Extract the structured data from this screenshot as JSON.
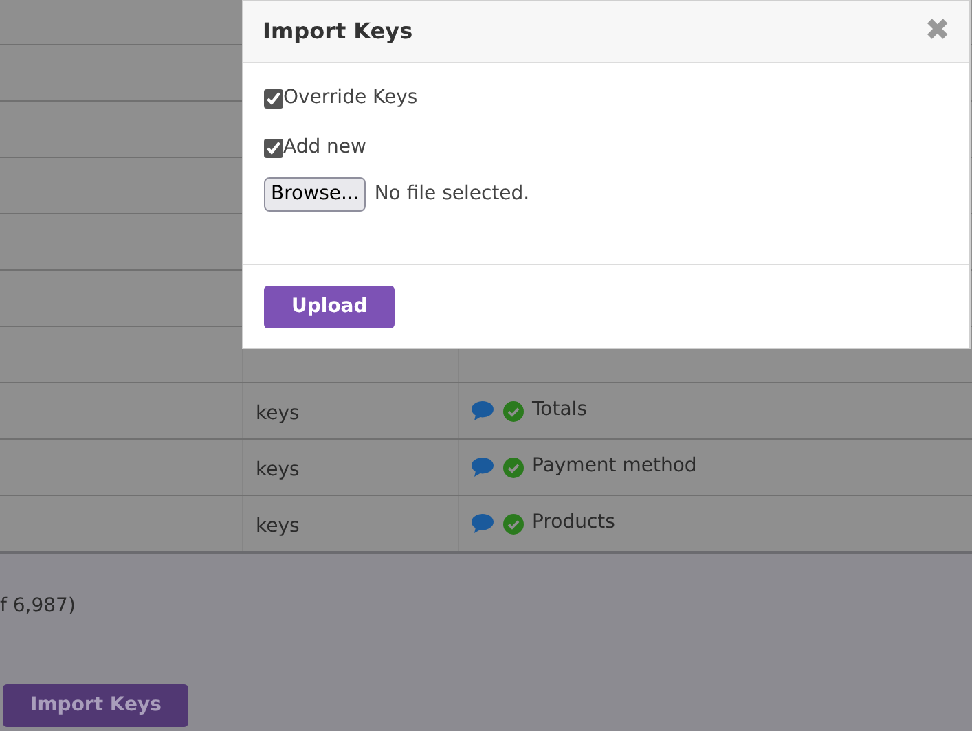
{
  "table": {
    "rows": [
      {
        "column_2": "keys",
        "column_3": "Totals"
      },
      {
        "column_2": "keys",
        "column_3": "Payment method"
      },
      {
        "column_2": "keys",
        "column_3": "Products"
      }
    ]
  },
  "pagination_text": "f 6,987)",
  "import_button": "Import Keys",
  "modal": {
    "title": "Import Keys",
    "close": "✖",
    "options": [
      {
        "label": "Override Keys",
        "checked": true
      },
      {
        "label": "Add new",
        "checked": true
      }
    ],
    "file": {
      "button": "Browse...",
      "status": "No file selected."
    },
    "submit": "Upload"
  }
}
